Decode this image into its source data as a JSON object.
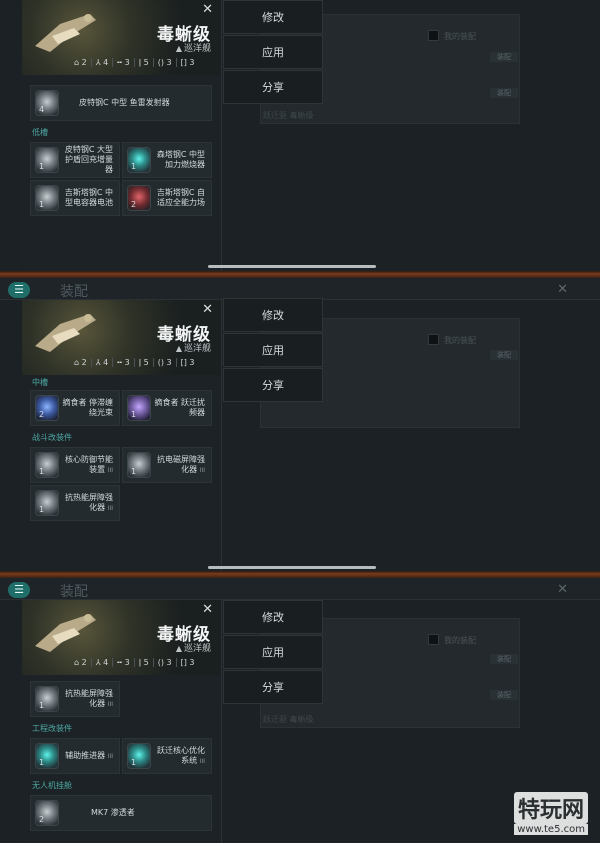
{
  "ship": {
    "name": "毒蜥级",
    "class": "巡洋舰",
    "stats": [
      "2",
      "4",
      "3",
      "5",
      "3",
      "3"
    ]
  },
  "actions": [
    "修改",
    "应用",
    "分享"
  ],
  "background": {
    "title": "装配",
    "text_a": "我的装配",
    "text_b": "跃迁驱 毒蜥级",
    "tag": "装配"
  },
  "panel1": {
    "sec0_items": [
      {
        "name": "皮特钢C 中型 鱼雷发射器",
        "qty": "4",
        "icon": "torpedo-launcher-icon"
      }
    ],
    "sec1_label": "低槽",
    "sec1_rows": [
      [
        {
          "name": "皮特钢C 大型护盾回充增量器",
          "qty": "1",
          "icon": "shield-recharger-icon"
        },
        {
          "name": "森塔钢C 中型加力燃烧器",
          "qty": "1",
          "icon": "afterburner-icon"
        }
      ],
      [
        {
          "name": "吉斯塔钢C 中型电容器电池",
          "qty": "1",
          "icon": "capacitor-battery-icon"
        },
        {
          "name": "吉斯塔钢C 自适应全能力场",
          "qty": "2",
          "icon": "adaptive-field-icon"
        }
      ]
    ]
  },
  "panel2": {
    "sec0_label": "中槽",
    "sec0_items": [
      {
        "name": "摘食者 停滞缠绕光束",
        "qty": "2",
        "icon": "stasis-web-icon"
      },
      {
        "name": "摘食者 跃迁扰频器",
        "qty": "1",
        "icon": "warp-scrambler-icon"
      }
    ],
    "sec1_label": "战斗改装件",
    "sec1_rows": [
      [
        {
          "name": "核心防御节能装置",
          "lvl": "III",
          "qty": "1",
          "icon": "core-defense-icon"
        },
        {
          "name": "抗电磁屏障强化器",
          "lvl": "III",
          "qty": "1",
          "icon": "em-hardener-icon"
        }
      ],
      [
        {
          "name": "抗热能屏障强化器",
          "lvl": "III",
          "qty": "1",
          "icon": "thermal-hardener-icon"
        }
      ]
    ]
  },
  "panel3": {
    "sec0_items": [
      {
        "name": "抗热能屏障强化器",
        "lvl": "III",
        "qty": "1",
        "icon": "thermal-hardener-icon"
      }
    ],
    "sec1_label": "工程改装件",
    "sec1_items": [
      {
        "name": "辅助推进器",
        "lvl": "III",
        "qty": "1",
        "icon": "aux-thruster-icon"
      },
      {
        "name": "跃迁核心优化系统",
        "lvl": "III",
        "qty": "1",
        "icon": "warp-core-icon"
      }
    ],
    "sec2_label": "无人机挂舱",
    "sec2_items": [
      {
        "name": "MK7 渗透者",
        "qty": "2",
        "icon": "drone-icon"
      }
    ]
  },
  "watermark": {
    "title": "特玩网",
    "url": "www.te5.com"
  }
}
